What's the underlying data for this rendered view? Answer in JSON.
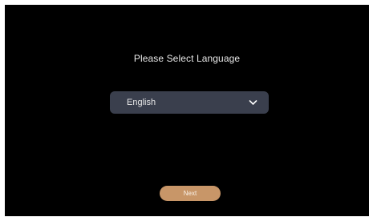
{
  "page": {
    "title": "Please Select Language"
  },
  "language_select": {
    "selected": "English",
    "icon": "chevron-down-icon"
  },
  "actions": {
    "next_label": "Next"
  },
  "colors": {
    "background": "#000000",
    "select_bg": "#3a3f4d",
    "accent": "#c89668",
    "text": "#e8e8e8"
  }
}
